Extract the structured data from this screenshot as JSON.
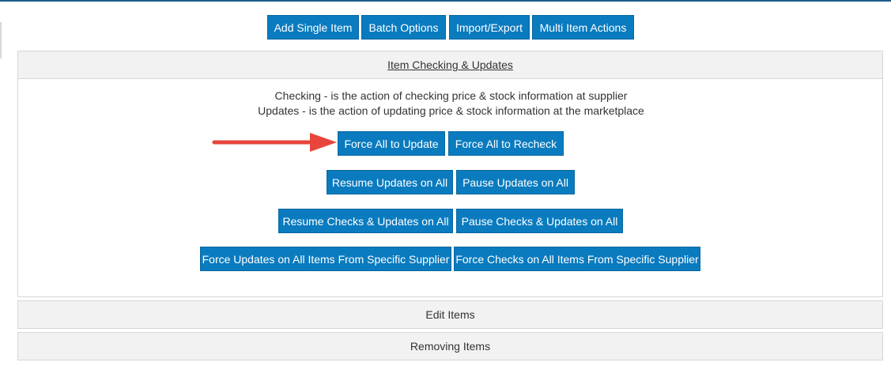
{
  "toolbar": {
    "add_single": "Add Single Item",
    "batch_options": "Batch Options",
    "import_export": "Import/Export",
    "multi_item": "Multi Item Actions"
  },
  "checking_panel": {
    "title": "Item Checking & Updates",
    "desc_checking": "Checking - is the action of checking price & stock information at supplier",
    "desc_updates": "Updates - is the action of updating price & stock information at the marketplace",
    "buttons": {
      "force_all_update": "Force All to Update",
      "force_all_recheck": "Force All to Recheck",
      "resume_updates": "Resume Updates on All",
      "pause_updates": "Pause Updates on All",
      "resume_checks_updates": "Resume Checks & Updates on All",
      "pause_checks_updates": "Pause Checks & Updates on All",
      "force_updates_supplier": "Force Updates on All Items From Specific Supplier",
      "force_checks_supplier": "Force Checks on All Items From Specific Supplier"
    }
  },
  "sections": {
    "edit_items": "Edit Items",
    "removing_items": "Removing Items"
  },
  "colors": {
    "button_bg": "#0a7bbf",
    "arrow": "#e8453c",
    "panel_bg": "#f2f2f2"
  },
  "icons": {
    "annotation": "red-arrow-icon"
  }
}
